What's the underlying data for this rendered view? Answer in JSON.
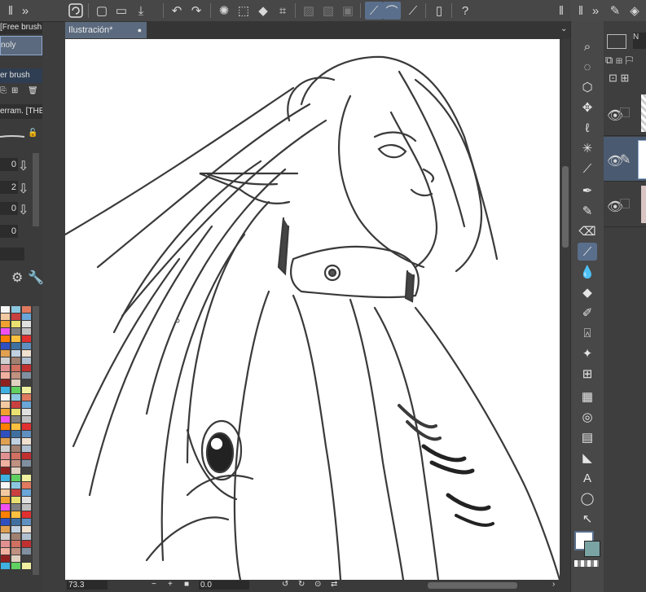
{
  "toolbar": {
    "icons": [
      "app-logo-icon",
      "new-file-icon",
      "open-folder-icon",
      "save-icon",
      "undo-icon",
      "redo-icon",
      "loading-icon",
      "transform-icon",
      "fill-icon",
      "crop-icon",
      "hide-selection-icon",
      "clear-icon",
      "fill-layer-icon",
      "stabilizer-icon",
      "stroke-icon",
      "pen-pressure-icon",
      "smartphone-icon",
      "help-icon"
    ]
  },
  "left_panel": {
    "sub_tool_title": "[Free brush",
    "brush_item_1": "noly",
    "brush_item_2": "er brush",
    "tool_property_title": "erram. [THE",
    "values": [
      "0",
      "2",
      "0",
      "0"
    ],
    "colors": {
      "accent": "#5a6f8c"
    }
  },
  "document": {
    "tab_label": "Ilustración*",
    "zoom": "73.3",
    "rotation": "0.0"
  },
  "colors": {
    "main": "#ffffff",
    "sub": "#7aa3a3"
  }
}
